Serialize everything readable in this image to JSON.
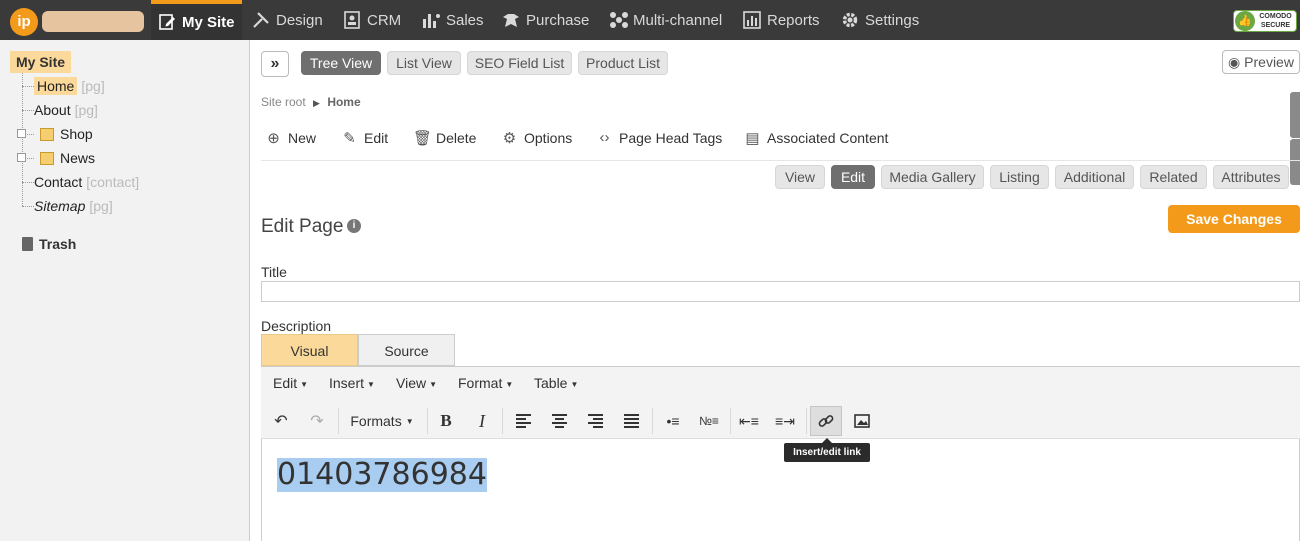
{
  "topnav": {
    "logo": "ip",
    "items": [
      {
        "label": "My Site",
        "icon": "edit-page-icon"
      },
      {
        "label": "Design",
        "icon": "brush-icon"
      },
      {
        "label": "CRM",
        "icon": "contacts-icon"
      },
      {
        "label": "Sales",
        "icon": "bar-chart-icon"
      },
      {
        "label": "Purchase",
        "icon": "hand-icon"
      },
      {
        "label": "Multi-channel",
        "icon": "network-icon"
      },
      {
        "label": "Reports",
        "icon": "report-icon"
      },
      {
        "label": "Settings",
        "icon": "gear-icon"
      }
    ],
    "badge": {
      "line1": "COMODO",
      "line2": "SECURE"
    }
  },
  "sidebar": {
    "root": "My Site",
    "items": [
      {
        "label": "Home",
        "tag": "[pg]"
      },
      {
        "label": "About",
        "tag": "[pg]"
      },
      {
        "label": "Shop",
        "tag": ""
      },
      {
        "label": "News",
        "tag": ""
      },
      {
        "label": "Contact",
        "tag": "[contact]"
      },
      {
        "label": "Sitemap",
        "tag": "[pg]"
      }
    ],
    "trash": "Trash"
  },
  "viewtabs": {
    "tree": "Tree View",
    "list": "List View",
    "seo": "SEO Field List",
    "product": "Product List",
    "preview": "Preview"
  },
  "breadcrumb": {
    "root": "Site root",
    "current": "Home"
  },
  "actions": {
    "new": "New",
    "edit": "Edit",
    "delete": "Delete",
    "options": "Options",
    "head_tags": "Page Head Tags",
    "associated": "Associated Content"
  },
  "subtabs": [
    "View",
    "Edit",
    "Media Gallery",
    "Listing",
    "Additional",
    "Related",
    "Attributes"
  ],
  "form": {
    "heading": "Edit Page",
    "save": "Save Changes",
    "title_label": "Title",
    "title_value": "",
    "description_label": "Description"
  },
  "editor": {
    "tab_visual": "Visual",
    "tab_source": "Source",
    "menus": [
      "Edit",
      "Insert",
      "View",
      "Format",
      "Table"
    ],
    "formats_label": "Formats",
    "tooltip": "Insert/edit link",
    "content": "01403786984"
  },
  "colors": {
    "accent": "#f49a1a",
    "topbar": "#3a3a3a",
    "selection": "#a9cdf0"
  }
}
